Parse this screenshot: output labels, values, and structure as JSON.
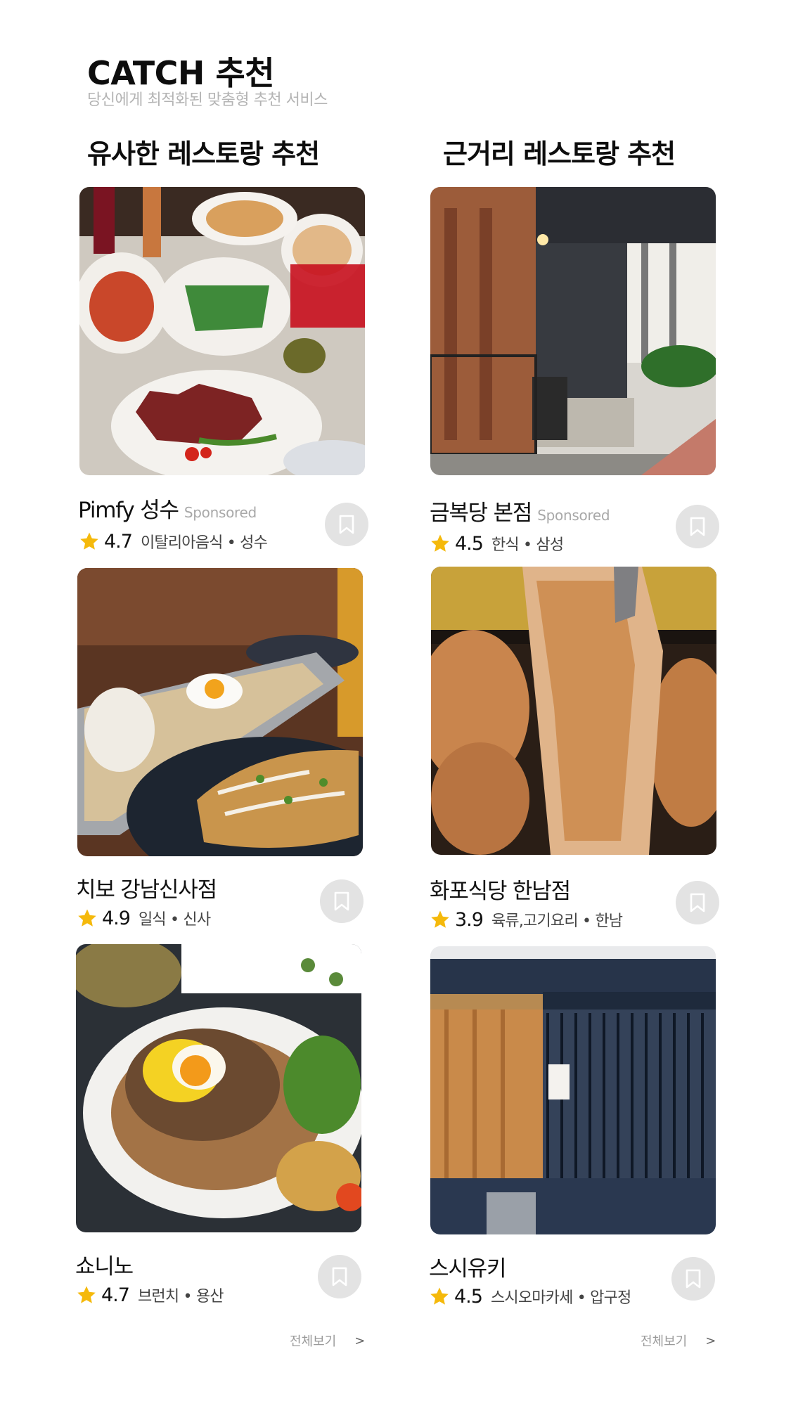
{
  "header": {
    "title": "CATCH 추천",
    "subtitle": "당신에게 최적화된 맞춤형 추천 서비스"
  },
  "sections": [
    {
      "title": "유사한 레스토랑 추천",
      "view_all": {
        "label": "전체보기",
        "chevron": ">"
      },
      "items": [
        {
          "name": "Pimfy 성수",
          "sponsored": "Sponsored",
          "rating": "4.7",
          "meta": "이탈리아음식 • 성수",
          "image": "italian-food-platter"
        },
        {
          "name": "치보 강남신사점",
          "sponsored": "",
          "rating": "4.9",
          "meta": "일식 • 신사",
          "image": "okonomiyaki-dishes"
        },
        {
          "name": "쇼니노",
          "sponsored": "",
          "rating": "4.7",
          "meta": "브런치 • 용산",
          "image": "brunch-toast-egg"
        }
      ]
    },
    {
      "title": "근거리 레스토랑 추천",
      "view_all": {
        "label": "전체보기",
        "chevron": ">"
      },
      "items": [
        {
          "name": "금복당 본점",
          "sponsored": "Sponsored",
          "rating": "4.5",
          "meta": "한식 • 삼성",
          "image": "restaurant-storefront"
        },
        {
          "name": "화포식당 한남점",
          "sponsored": "",
          "rating": "3.9",
          "meta": "육류,고기요리 • 한남",
          "image": "grilled-pork-tongs"
        },
        {
          "name": "스시유키",
          "sponsored": "",
          "rating": "4.5",
          "meta": "스시오마카세 • 압구정",
          "image": "wooden-facade-building"
        }
      ]
    }
  ],
  "icons": {
    "star": "star-icon",
    "bookmark": "bookmark-icon"
  },
  "colors": {
    "star": "#f5b90b",
    "bookmark_bg": "#e3e3e3",
    "sponsored": "#a8a8a8"
  }
}
